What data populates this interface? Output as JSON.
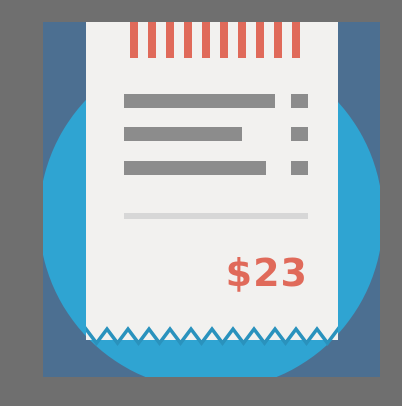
{
  "colors": {
    "frame": "#6f6f6f",
    "backdrop": "#4c6f91",
    "circle": "#2fa4d2",
    "circle_shadow": "#2a92bd",
    "paper": "#f2f1ef",
    "stripe": "#e06a5a",
    "line_item": "#8c8c8c",
    "divider": "#d7d7d7",
    "price": "#e06a5a"
  },
  "icon": "receipt-icon",
  "receipt": {
    "total": "$23",
    "line_items": 3
  }
}
